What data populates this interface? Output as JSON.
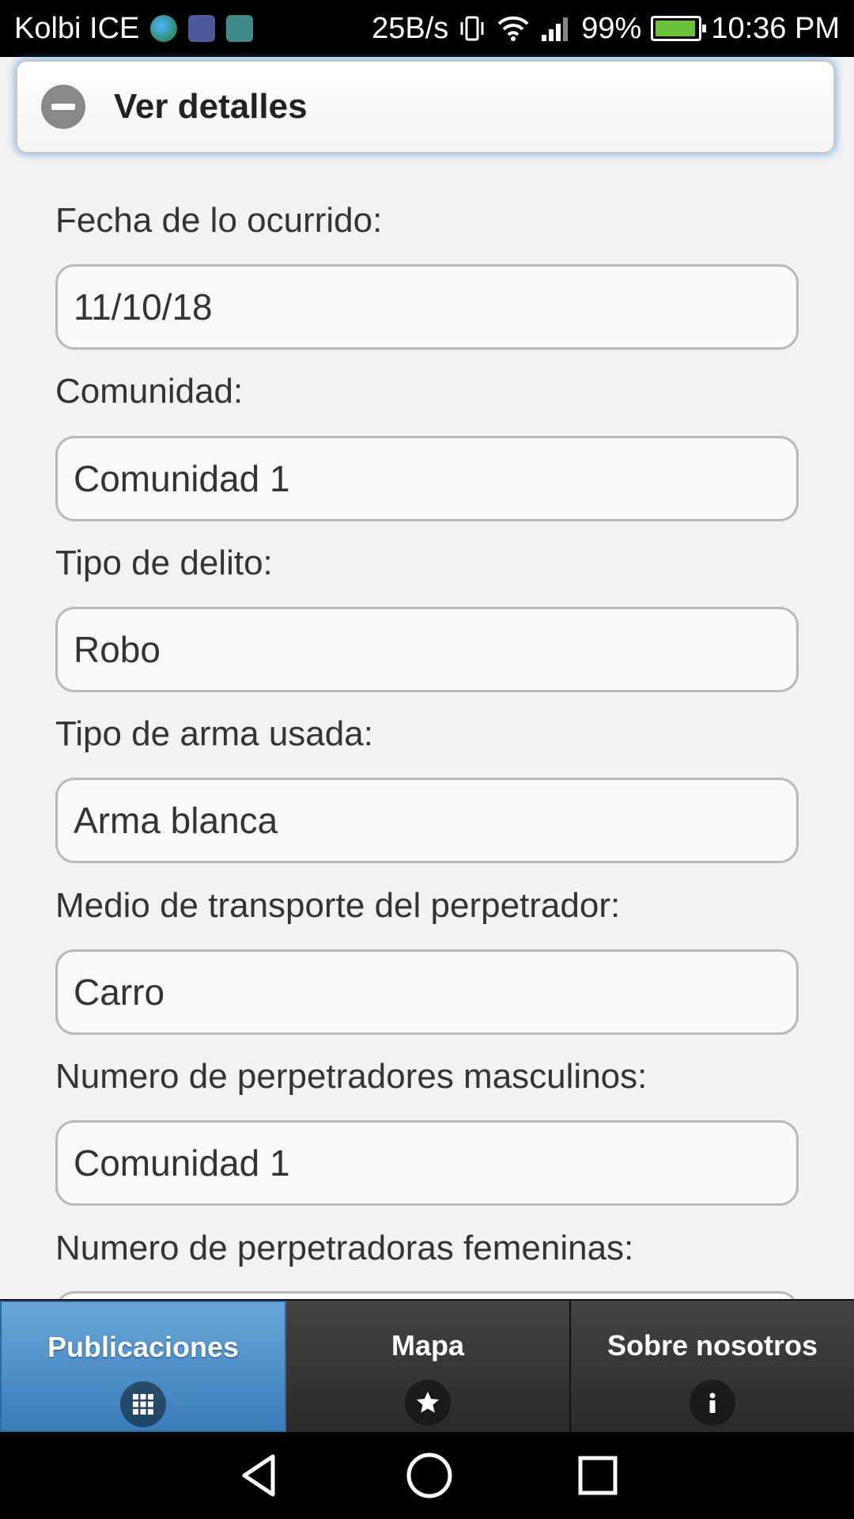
{
  "status_bar": {
    "carrier": "Kolbi ICE",
    "net_speed": "25B/s",
    "battery": "99%",
    "time": "10:36 PM"
  },
  "collapsible": {
    "title": "Ver detalles",
    "icon": "minus-icon"
  },
  "form": {
    "fields": [
      {
        "label": "Fecha de lo ocurrido:",
        "value": "11/10/18"
      },
      {
        "label": "Comunidad:",
        "value": "Comunidad 1"
      },
      {
        "label": "Tipo de delito:",
        "value": "Robo"
      },
      {
        "label": "Tipo de arma usada:",
        "value": "Arma blanca"
      },
      {
        "label": "Medio de transporte del perpetrador:",
        "value": "Carro"
      },
      {
        "label": "Numero de perpetradores masculinos:",
        "value": "Comunidad 1"
      },
      {
        "label": "Numero de perpetradoras femeninas:",
        "value": ""
      }
    ]
  },
  "navbar": {
    "tabs": [
      {
        "label": "Publicaciones",
        "icon": "grid-icon",
        "active": true
      },
      {
        "label": "Mapa",
        "icon": "star-icon",
        "active": false
      },
      {
        "label": "Sobre nosotros",
        "icon": "info-icon",
        "active": false
      }
    ]
  },
  "colors": {
    "active_tab": "#3a7cb8",
    "focus_glow": "#388cdc"
  }
}
